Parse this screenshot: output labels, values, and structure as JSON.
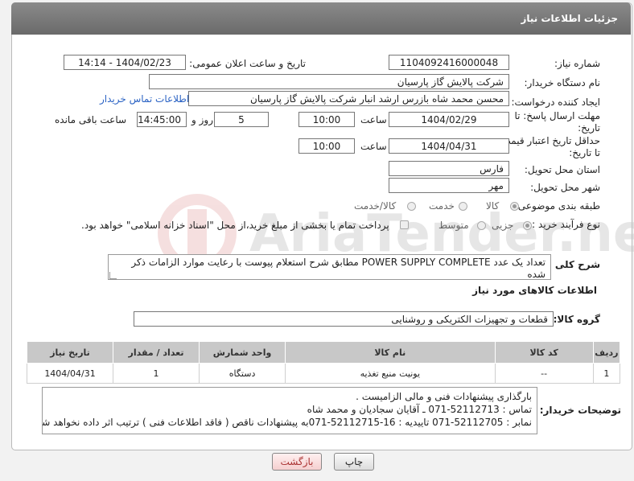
{
  "header": {
    "title": "جزئیات اطلاعات نیاز"
  },
  "fields": {
    "need_number_label": "شماره نیاز:",
    "need_number": "1104092416000048",
    "announce_label": "تاریخ و ساعت اعلان عمومی:",
    "announce_value": "1404/02/23 - 14:14",
    "buyer_org_label": "نام دستگاه خریدار:",
    "buyer_org": "شرکت پالایش گاز پارسیان",
    "requester_label": "ایجاد کننده درخواست:",
    "requester": "محسن محمد شاه بازرس ارشد انبار شرکت پالایش گاز پارسیان",
    "contact_link": "اطلاعات تماس خریدار",
    "deadline_label_1": "مهلت ارسال پاسخ: تا",
    "deadline_label_2": "تاریخ:",
    "deadline_date": "1404/02/29",
    "time_label": "ساعت",
    "deadline_time": "10:00",
    "days_value": "5",
    "days_label": "روز و",
    "remaining_time": "14:45:00",
    "remaining_label": "ساعت باقی مانده",
    "min_validity_label_1": "حداقل تاریخ اعتبار قیمت:",
    "min_validity_label_2": "تا تاریخ:",
    "validity_date": "1404/04/31",
    "validity_time": "10:00",
    "province_label": "استان محل تحویل:",
    "province": "فارس",
    "city_label": "شهر محل تحویل:",
    "city": "مهر",
    "category_label": "طبقه بندی موضوعی:",
    "category_options": [
      "کالا",
      "خدمت",
      "کالا/خدمت"
    ],
    "process_label": "نوع فرآیند خرید :",
    "process_options": [
      "جزیی",
      "متوسط"
    ],
    "payment_note": "پرداخت تمام یا بخشی از مبلغ خرید،از محل \"اسناد خزانه اسلامی\" خواهد بود.",
    "description_label": "شرح کلی نیاز:",
    "description": "تعداد یک عدد POWER SUPPLY COMPLETE مطابق شرح استعلام پیوست با رعایت موارد الزامات ذکر شده",
    "goods_info_title": "اطلاعات کالاهای مورد نیاز",
    "goods_group_label": "گروه کالا:",
    "goods_group": "قطعات و تجهیزات الکتریکی و روشنایی"
  },
  "table": {
    "headers": [
      "ردیف",
      "کد کالا",
      "نام کالا",
      "واحد شمارش",
      "تعداد / مقدار",
      "تاریخ نیاز"
    ],
    "rows": [
      [
        "1",
        "--",
        "یونیت منبع تغذیه",
        "دستگاه",
        "1",
        "1404/04/31"
      ]
    ]
  },
  "buyer_notes": {
    "label": "توضیحات خریدار:",
    "lines": [
      "بارگذاری پیشنهادات فنی و مالی الزامیست .",
      "تماس : 52112713-071 ـ آقایان سجادیان و محمد شاه",
      "نمابر : 52112705-071 تاییدیه : 16-52112715-071به پیشنهادات ناقص ( فاقد اطلاعات فنی ) ترتیب اثر داده نخواهد شد."
    ]
  },
  "buttons": {
    "print": "چاپ",
    "back": "بازگشت"
  },
  "watermark_text": "AriaTender.neT",
  "colors": {
    "header_bg": "#777777",
    "link": "#2b63c4",
    "back_button": "#f5cfcf"
  }
}
